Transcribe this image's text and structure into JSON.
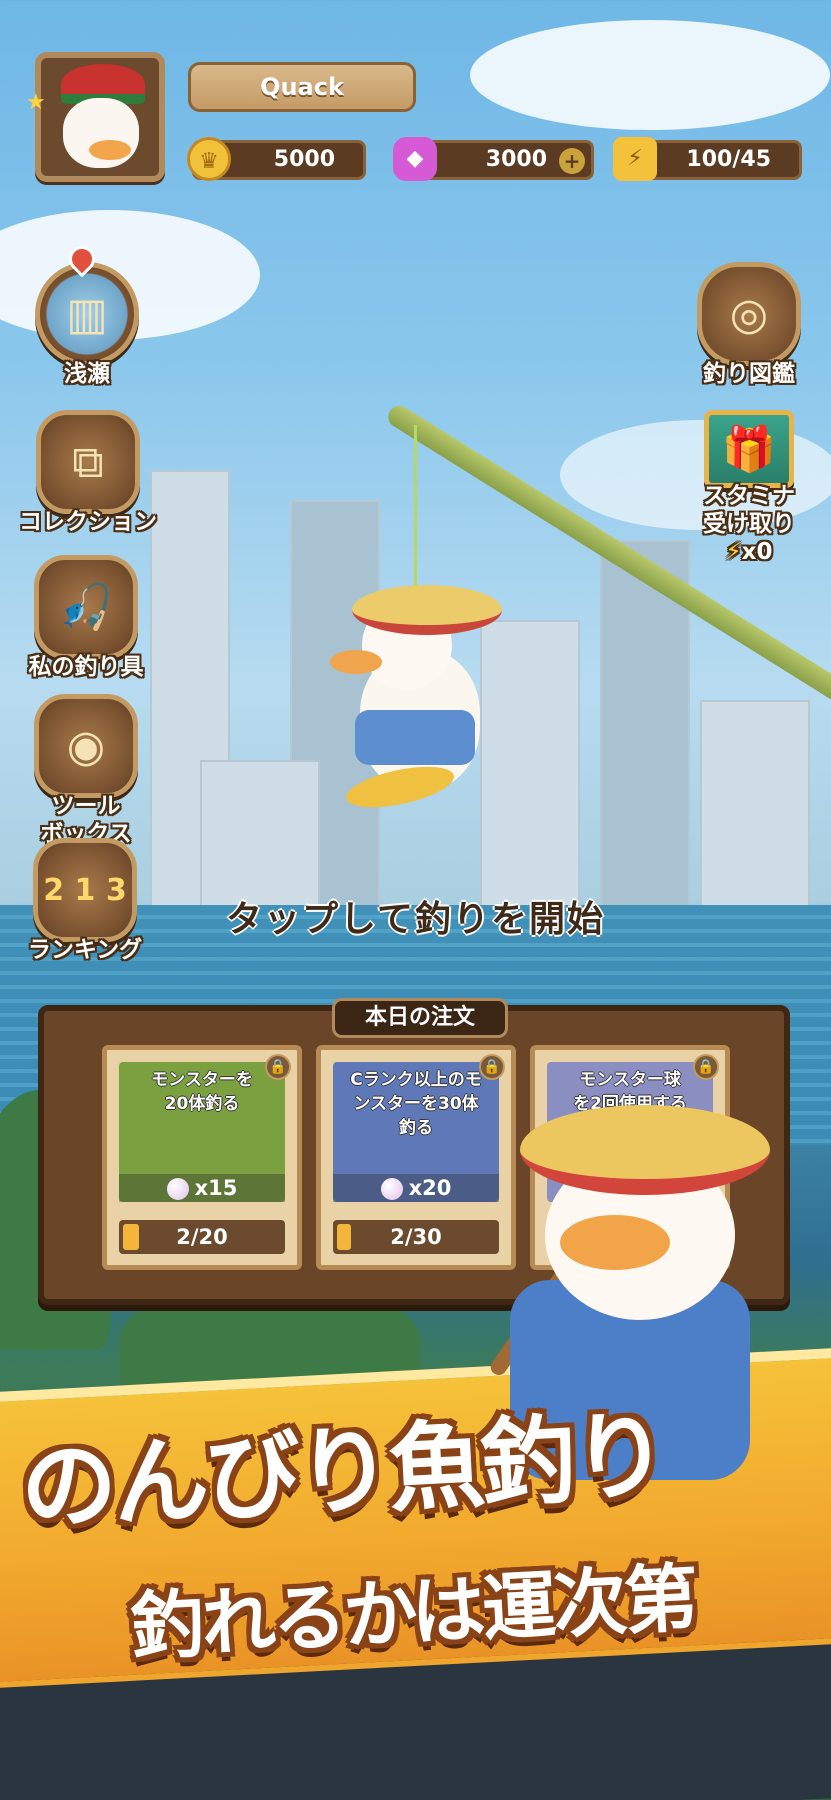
{
  "player": {
    "name": "Quack",
    "coins": "5000",
    "gems": "3000",
    "stamina": "100/45"
  },
  "left_menu": [
    {
      "label": "浅瀬",
      "icon": "location-city-icon"
    },
    {
      "label": "コレクション",
      "icon": "collection-icon"
    },
    {
      "label": "私の釣り具",
      "icon": "fishing-gear-icon"
    },
    {
      "label": "ツール\nボックス",
      "icon": "toolbox-icon"
    },
    {
      "label": "ランキング",
      "icon": "ranking-podium-icon"
    }
  ],
  "right_menu": {
    "encyclopedia": {
      "label": "釣り図鑑",
      "icon": "fishing-encyclopedia-icon"
    },
    "stamina": {
      "label_line1": "スタミナ",
      "label_line2": "受け取り",
      "count": "x0",
      "icon": "gift-box-icon"
    }
  },
  "tap_prompt": "タップして釣りを開始",
  "orders": {
    "title": "本日の注文",
    "items": [
      {
        "task": "モンスターを\n20体釣る",
        "reward": "x15",
        "progress": "2/20",
        "progress_fraction": 0.1,
        "color": "#7aa040"
      },
      {
        "task": "Cランク以上のモ\nンスターを30体\n釣る",
        "reward": "x20",
        "progress": "2/30",
        "progress_fraction": 0.067,
        "color": "#5f79b8"
      },
      {
        "task": "モンスター球\nを2回使用する",
        "reward": "",
        "progress": "",
        "progress_fraction": 0,
        "color": "#8a8ec0"
      }
    ]
  },
  "banner": {
    "headline": "のんびり魚釣り",
    "subline": "釣れるかは運次第"
  },
  "colors": {
    "accent_orange": "#f0a52c",
    "wood_brown": "#6a4527",
    "outline_brown": "#8a4316"
  }
}
